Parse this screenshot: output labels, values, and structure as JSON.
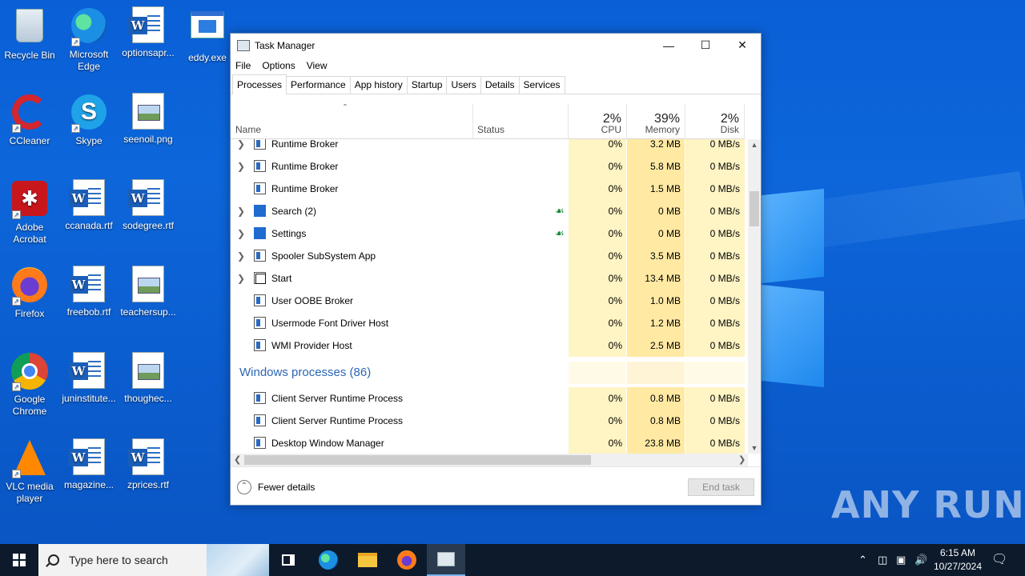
{
  "desktop": {
    "icons": [
      {
        "label": "Recycle Bin",
        "icon": "recycle-bin-icon"
      },
      {
        "label": "Microsoft Edge",
        "icon": "edge-icon"
      },
      {
        "label": "optionsapr...",
        "icon": "word-doc-icon"
      },
      {
        "label": "eddy.exe",
        "icon": "exe-icon"
      },
      {
        "label": "CCleaner",
        "icon": "ccleaner-icon"
      },
      {
        "label": "Skype",
        "icon": "skype-icon"
      },
      {
        "label": "seenoil.png",
        "icon": "image-file-icon"
      },
      {
        "label": "Adobe Acrobat",
        "icon": "acrobat-icon"
      },
      {
        "label": "ccanada.rtf",
        "icon": "word-doc-icon"
      },
      {
        "label": "sodegree.rtf",
        "icon": "word-doc-icon"
      },
      {
        "label": "Firefox",
        "icon": "firefox-icon"
      },
      {
        "label": "freebob.rtf",
        "icon": "word-doc-icon"
      },
      {
        "label": "teachersup...",
        "icon": "image-file-icon"
      },
      {
        "label": "Google Chrome",
        "icon": "chrome-icon"
      },
      {
        "label": "juninstitute...",
        "icon": "word-doc-icon"
      },
      {
        "label": "thoughec...",
        "icon": "image-file-icon"
      },
      {
        "label": "VLC media player",
        "icon": "vlc-icon"
      },
      {
        "label": "magazine...",
        "icon": "word-doc-icon"
      },
      {
        "label": "zprices.rtf",
        "icon": "word-doc-icon"
      }
    ],
    "watermark": "ANY RUN"
  },
  "taskmanager": {
    "title": "Task Manager",
    "menu": [
      "File",
      "Options",
      "View"
    ],
    "tabs": [
      "Processes",
      "Performance",
      "App history",
      "Startup",
      "Users",
      "Details",
      "Services"
    ],
    "active_tab": "Processes",
    "columns": {
      "name": "Name",
      "status": "Status",
      "cpu_pct": "2%",
      "cpu": "CPU",
      "mem_pct": "39%",
      "mem": "Memory",
      "disk_pct": "2%",
      "disk": "Disk"
    },
    "rows": [
      {
        "type": "proc",
        "expand": true,
        "name": "Runtime Broker",
        "leaf": false,
        "cpu": "0%",
        "mem": "3.2 MB",
        "disk": "0 MB/s",
        "icon": "app-window-icon"
      },
      {
        "type": "proc",
        "expand": true,
        "name": "Runtime Broker",
        "leaf": false,
        "cpu": "0%",
        "mem": "5.8 MB",
        "disk": "0 MB/s",
        "icon": "app-window-icon"
      },
      {
        "type": "proc",
        "expand": false,
        "name": "Runtime Broker",
        "leaf": false,
        "cpu": "0%",
        "mem": "1.5 MB",
        "disk": "0 MB/s",
        "icon": "app-window-icon"
      },
      {
        "type": "proc",
        "expand": true,
        "name": "Search (2)",
        "leaf": true,
        "cpu": "0%",
        "mem": "0 MB",
        "disk": "0 MB/s",
        "icon": "search-app-icon"
      },
      {
        "type": "proc",
        "expand": true,
        "name": "Settings",
        "leaf": true,
        "cpu": "0%",
        "mem": "0 MB",
        "disk": "0 MB/s",
        "icon": "settings-gear-icon"
      },
      {
        "type": "proc",
        "expand": true,
        "name": "Spooler SubSystem App",
        "leaf": false,
        "cpu": "0%",
        "mem": "3.5 MB",
        "disk": "0 MB/s",
        "icon": "printer-icon"
      },
      {
        "type": "proc",
        "expand": true,
        "name": "Start",
        "leaf": false,
        "cpu": "0%",
        "mem": "13.4 MB",
        "disk": "0 MB/s",
        "icon": "start-window-icon"
      },
      {
        "type": "proc",
        "expand": false,
        "name": "User OOBE Broker",
        "leaf": false,
        "cpu": "0%",
        "mem": "1.0 MB",
        "disk": "0 MB/s",
        "icon": "app-window-icon"
      },
      {
        "type": "proc",
        "expand": false,
        "name": "Usermode Font Driver Host",
        "leaf": false,
        "cpu": "0%",
        "mem": "1.2 MB",
        "disk": "0 MB/s",
        "icon": "app-window-icon"
      },
      {
        "type": "proc",
        "expand": false,
        "name": "WMI Provider Host",
        "leaf": false,
        "cpu": "0%",
        "mem": "2.5 MB",
        "disk": "0 MB/s",
        "icon": "wmi-icon"
      },
      {
        "type": "group",
        "name": "Windows processes (86)"
      },
      {
        "type": "proc",
        "expand": false,
        "name": "Client Server Runtime Process",
        "leaf": false,
        "cpu": "0%",
        "mem": "0.8 MB",
        "disk": "0 MB/s",
        "icon": "app-window-icon"
      },
      {
        "type": "proc",
        "expand": false,
        "name": "Client Server Runtime Process",
        "leaf": false,
        "cpu": "0%",
        "mem": "0.8 MB",
        "disk": "0 MB/s",
        "icon": "app-window-icon"
      },
      {
        "type": "proc",
        "expand": false,
        "name": "Desktop Window Manager",
        "leaf": false,
        "cpu": "0%",
        "mem": "23.8 MB",
        "disk": "0 MB/s",
        "icon": "app-window-icon"
      }
    ],
    "fewer_details": "Fewer details",
    "end_task": "End task"
  },
  "taskbar": {
    "search_placeholder": "Type here to search",
    "time": "6:15 AM",
    "date": "10/27/2024",
    "pinned": [
      "task-view-icon",
      "edge-icon",
      "file-explorer-icon",
      "firefox-icon",
      "task-manager-icon"
    ]
  }
}
